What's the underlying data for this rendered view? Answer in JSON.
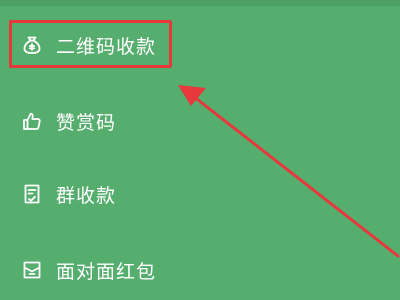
{
  "menu": {
    "items": [
      {
        "label": "二维码收款",
        "icon": "money-bag-icon"
      },
      {
        "label": "赞赏码",
        "icon": "thumbs-up-icon"
      },
      {
        "label": "群收款",
        "icon": "group-receipt-icon"
      },
      {
        "label": "面对面红包",
        "icon": "red-packet-icon"
      }
    ]
  },
  "annotation": {
    "highlight_color": "#e8383d",
    "highlighted_item": "二维码收款"
  },
  "colors": {
    "background": "#55ad6e",
    "text": "#ffffff"
  }
}
